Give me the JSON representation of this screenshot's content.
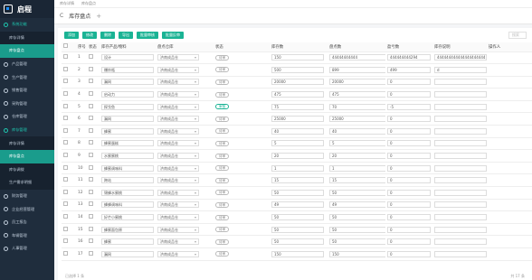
{
  "app": {
    "name": "启程"
  },
  "sidebar": {
    "items": [
      {
        "label": "系统功能",
        "type": "top",
        "state": "open"
      },
      {
        "label": "库存详情",
        "type": "sub"
      },
      {
        "label": "库存盘点",
        "type": "sub",
        "state": "active"
      },
      {
        "label": "产品管理",
        "type": "top"
      },
      {
        "label": "生产管理",
        "type": "top"
      },
      {
        "label": "销售管理",
        "type": "top"
      },
      {
        "label": "采购管理",
        "type": "top"
      },
      {
        "label": "仓库管理",
        "type": "top"
      },
      {
        "label": "库存管理",
        "type": "top",
        "state": "open"
      },
      {
        "label": "库存详情",
        "type": "sub"
      },
      {
        "label": "库存盘点",
        "type": "sub",
        "state": "active"
      },
      {
        "label": "库存调拨",
        "type": "sub"
      },
      {
        "label": "生产需求明细",
        "type": "sub"
      },
      {
        "label": "财务管理",
        "type": "top"
      },
      {
        "label": "企业经营管理",
        "type": "top"
      },
      {
        "label": "员工报告",
        "type": "top"
      },
      {
        "label": "车辆管理",
        "type": "top"
      },
      {
        "label": "人事管理",
        "type": "top"
      }
    ]
  },
  "topbar": {
    "links": [
      "库存详情",
      "库存盘点"
    ]
  },
  "tabbar": {
    "refresh": "C",
    "title": "库存盘点",
    "plus": "+"
  },
  "toolbar": {
    "buttons": [
      "添加",
      "修改",
      "删除",
      "导出",
      "批量审核",
      "批量反审"
    ],
    "search_placeholder": "搜索"
  },
  "table": {
    "headers": [
      "序号",
      "状态",
      "库存产品/物料",
      "盘点仓库",
      "状态",
      "库存数",
      "盘点数",
      "盈亏数",
      "库存说明",
      "操作人"
    ],
    "rows": [
      {
        "no": "1",
        "product": "设计",
        "warehouse": "济南成品仓",
        "tag": "待审",
        "stock": "150",
        "count": "44444444444",
        "diff": "444444444294",
        "remark": "444444444444444444444",
        "action": "已审核"
      },
      {
        "no": "2",
        "product": "爆炸瓶",
        "warehouse": "济南成品仓",
        "tag": "待审",
        "stock": "500",
        "count": "899",
        "diff": "499",
        "remark": "d",
        "action": "已审核"
      },
      {
        "no": "3",
        "product": "漏网",
        "warehouse": "济南成品仓",
        "tag": "待审",
        "stock": "20000",
        "count": "20000",
        "diff": "0",
        "remark": "",
        "action": "已审核"
      },
      {
        "no": "4",
        "product": "启动力",
        "warehouse": "济南成品仓",
        "tag": "待审",
        "stock": "475",
        "count": "475",
        "diff": "0",
        "remark": "",
        "action": "已审核"
      },
      {
        "no": "5",
        "product": "探戈鱼",
        "warehouse": "济南成品仓",
        "tag": "审核",
        "tagGreen": true,
        "stock": "75",
        "count": "70",
        "diff": "-5",
        "remark": "",
        "action": "已审核"
      },
      {
        "no": "6",
        "product": "漏网",
        "warehouse": "济南成品仓",
        "tag": "待审",
        "stock": "25000",
        "count": "25000",
        "diff": "0",
        "remark": "",
        "action": "已审核"
      },
      {
        "no": "7",
        "product": "蜂蜜",
        "warehouse": "济南成品仓",
        "tag": "待审",
        "stock": "40",
        "count": "40",
        "diff": "0",
        "remark": "",
        "action": "已审核"
      },
      {
        "no": "8",
        "product": "蜂蜜蛋糕",
        "warehouse": "济南成品仓",
        "tag": "待审",
        "stock": "5",
        "count": "5",
        "diff": "0",
        "remark": "",
        "action": "已审核"
      },
      {
        "no": "9",
        "product": "水蜜蜜桃",
        "warehouse": "济南成品仓",
        "tag": "待审",
        "stock": "20",
        "count": "20",
        "diff": "0",
        "remark": "",
        "action": "已审核"
      },
      {
        "no": "10",
        "product": "蜂蜜调味料",
        "warehouse": "济南成品仓",
        "tag": "待审",
        "stock": "1",
        "count": "1",
        "diff": "0",
        "remark": "",
        "action": "已审核"
      },
      {
        "no": "11",
        "product": "跨站",
        "warehouse": "济南成品仓",
        "tag": "待审",
        "stock": "15",
        "count": "15",
        "diff": "0",
        "remark": "",
        "action": "已审核"
      },
      {
        "no": "12",
        "product": "锦蜂水蜜桃",
        "warehouse": "济南成品仓",
        "tag": "待审",
        "stock": "50",
        "count": "50",
        "diff": "0",
        "remark": "",
        "action": "已审核"
      },
      {
        "no": "13",
        "product": "蜂蜂调味料",
        "warehouse": "济南成品仓",
        "tag": "待审",
        "stock": "49",
        "count": "49",
        "diff": "0",
        "remark": "",
        "action": "已审核"
      },
      {
        "no": "14",
        "product": "好芒小蜜桃",
        "warehouse": "济南成品仓",
        "tag": "待审",
        "stock": "50",
        "count": "50",
        "diff": "0",
        "remark": "",
        "action": "已审核"
      },
      {
        "no": "15",
        "product": "蜂蜜面包原",
        "warehouse": "济南成品仓",
        "tag": "待审",
        "stock": "50",
        "count": "50",
        "diff": "0",
        "remark": "",
        "action": "已审核"
      },
      {
        "no": "16",
        "product": "蜂蜜",
        "warehouse": "济南成品仓",
        "tag": "待审",
        "stock": "50",
        "count": "50",
        "diff": "0",
        "remark": "",
        "action": "已审核"
      },
      {
        "no": "17",
        "product": "漏网",
        "warehouse": "济南成品仓",
        "tag": "待审",
        "stock": "150",
        "count": "150",
        "diff": "0",
        "remark": "",
        "action": "已审核"
      }
    ]
  },
  "footer": {
    "left": "已选择 1 条",
    "right": "共 17 条"
  }
}
